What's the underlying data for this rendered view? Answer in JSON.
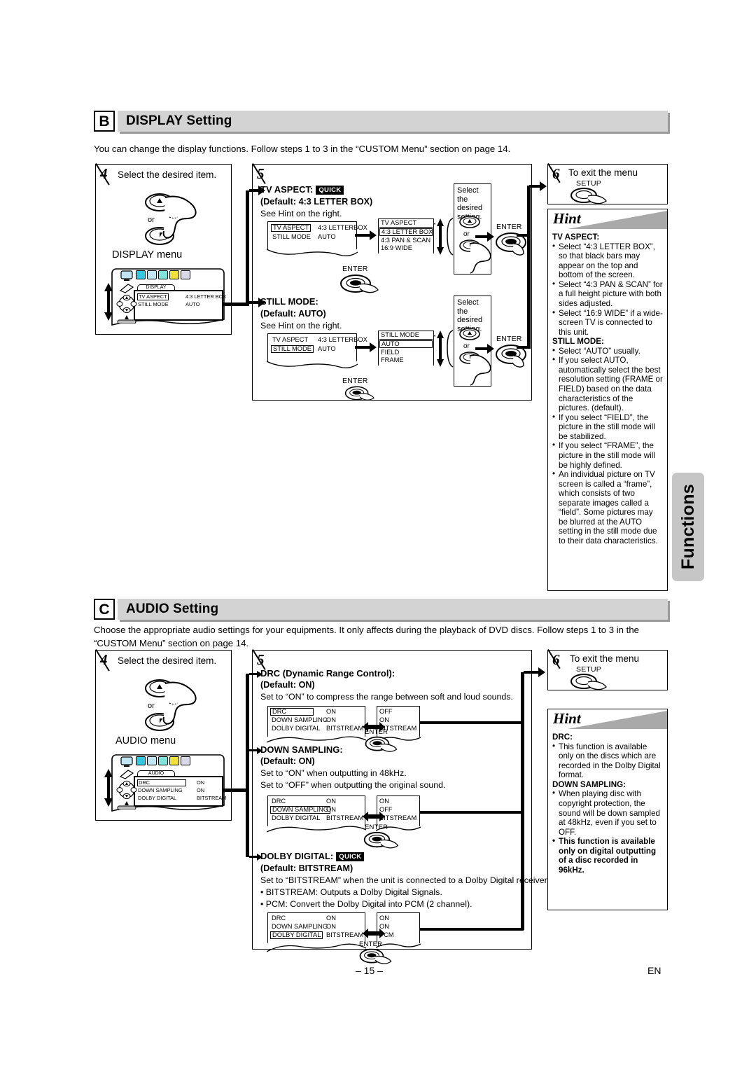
{
  "page": {
    "number": "– 15 –",
    "lang": "EN",
    "side_tab": "Functions"
  },
  "section_b": {
    "letter": "B",
    "title": "DISPLAY Setting",
    "intro": "You can change the display functions. Follow steps 1 to 3 in the “CUSTOM Menu” section on page 14.",
    "step4": {
      "number": "4",
      "label": "Select the desired item.",
      "or": "or",
      "menu_caption": "DISPLAY menu",
      "menu_tab": "DISPLAY",
      "menu_rows": [
        {
          "name": "TV ASPECT",
          "value": "4:3 LETTER BOX",
          "selected": true
        },
        {
          "name": "STILL MODE",
          "value": "AUTO",
          "selected": false
        }
      ],
      "enter_label": "ENTER"
    },
    "step5": {
      "number": "5",
      "items": [
        {
          "title": "TV ASPECT:",
          "quick": "QUICK",
          "default": "(Default: 4:3 LETTER BOX)",
          "note": "See Hint on the right.",
          "osd_rows": [
            {
              "name": "TV ASPECT",
              "value": "4:3 LETTERBOX",
              "selected": true
            },
            {
              "name": "STILL MODE",
              "value": "AUTO",
              "selected": false
            }
          ],
          "list_header": "TV ASPECT",
          "list_options": [
            "4:3 LETTER BOX",
            "4:3 PAN & SCAN",
            "16:9 WIDE"
          ],
          "list_selected": 0,
          "enter_label": "ENTER"
        },
        {
          "title": "STILL MODE:",
          "quick": "",
          "default": "(Default: AUTO)",
          "note": "See Hint on the right.",
          "osd_rows": [
            {
              "name": "TV ASPECT",
              "value": "4:3 LETTERBOX",
              "selected": false
            },
            {
              "name": "STILL MODE",
              "value": "AUTO",
              "selected": true
            }
          ],
          "list_header": "STILL MODE",
          "list_options": [
            "AUTO",
            "FIELD",
            "FRAME"
          ],
          "list_selected": 0,
          "enter_label": "ENTER"
        }
      ],
      "select_setting": {
        "l1": "Select the",
        "l2": "desired",
        "l3": "setting.",
        "or": "or"
      },
      "enter_label": "ENTER"
    },
    "step6": {
      "number": "6",
      "label": "To exit the menu",
      "setup_label": "SETUP"
    },
    "hint": {
      "title": "Hint",
      "groups": [
        {
          "heading": "TV ASPECT:",
          "bullets": [
            "Select “4:3 LETTER BOX”, so that black bars may appear on the top and bottom of the screen.",
            "Select “4:3 PAN & SCAN” for a full height picture with both sides adjusted.",
            "Select “16:9 WIDE” if a wide-screen TV is connected to this unit."
          ]
        },
        {
          "heading": "STILL MODE:",
          "bullets": [
            "Select “AUTO” usually.",
            "If you select AUTO, automatically select the best resolution setting (FRAME or FIELD) based on the data characteristics of the pictures. (default).",
            "If you select “FIELD”, the picture in the still mode will be stabilized.",
            "If you select “FRAME”, the picture in the still mode will be highly defined.",
            "An individual picture on TV screen is called a “frame”, which consists of two separate images called a “field”. Some pictures may be blurred at the AUTO setting in the still mode due to their data characteristics."
          ]
        }
      ]
    }
  },
  "section_c": {
    "letter": "C",
    "title": "AUDIO Setting",
    "intro": "Choose the appropriate audio settings for your equipments. It only affects during the playback of DVD discs. Follow steps 1 to 3 in the “CUSTOM Menu” section on page 14.",
    "step4": {
      "number": "4",
      "label": "Select the desired item.",
      "or": "or",
      "menu_caption": "AUDIO menu",
      "menu_tab": "AUDIO",
      "menu_rows": [
        {
          "name": "DRC",
          "value": "ON",
          "selected": true
        },
        {
          "name": "DOWN SAMPLING",
          "value": "ON",
          "selected": false
        },
        {
          "name": "DOLBY DIGITAL",
          "value": "BITSTREAM",
          "selected": false
        }
      ]
    },
    "step5": {
      "number": "5",
      "items": [
        {
          "title": "DRC (Dynamic Range Control):",
          "quick": "",
          "default": "(Default: ON)",
          "lines": [
            "Set to “ON” to compress the range between soft and loud sounds."
          ],
          "osd_rows": [
            {
              "name": "DRC",
              "value": "ON",
              "selected": true
            },
            {
              "name": "DOWN SAMPLING",
              "value": "ON",
              "selected": false
            },
            {
              "name": "DOLBY DIGITAL",
              "value": "BITSTREAM",
              "selected": false
            }
          ],
          "alt_values": [
            "OFF",
            "ON",
            "BITSTREAM"
          ],
          "enter_label": "ENTER"
        },
        {
          "title": "DOWN SAMPLING:",
          "quick": "",
          "default": "(Default: ON)",
          "lines": [
            "Set to “ON” when outputting in 48kHz.",
            "Set to “OFF” when outputting the original sound."
          ],
          "osd_rows": [
            {
              "name": "DRC",
              "value": "ON",
              "selected": false
            },
            {
              "name": "DOWN SAMPLING",
              "value": "ON",
              "selected": true
            },
            {
              "name": "DOLBY DIGITAL",
              "value": "BITSTREAM",
              "selected": false
            }
          ],
          "alt_values": [
            "ON",
            "OFF",
            "BITSTREAM"
          ],
          "enter_label": "ENTER"
        },
        {
          "title": "DOLBY DIGITAL:",
          "quick": "QUICK",
          "default": "(Default: BITSTREAM)",
          "lines": [
            "Set to “BITSTREAM” when the unit is connected to a Dolby Digital receiver.",
            "• BITSTREAM: Outputs a Dolby Digital Signals.",
            "• PCM: Convert the Dolby Digital into PCM (2 channel)."
          ],
          "osd_rows": [
            {
              "name": "DRC",
              "value": "ON",
              "selected": false
            },
            {
              "name": "DOWN SAMPLING",
              "value": "ON",
              "selected": false
            },
            {
              "name": "DOLBY DIGITAL",
              "value": "BITSTREAM",
              "selected": true
            }
          ],
          "alt_values": [
            "ON",
            "ON",
            "PCM"
          ],
          "enter_label": "ENTER"
        }
      ]
    },
    "step6": {
      "number": "6",
      "label": "To exit the menu",
      "setup_label": "SETUP"
    },
    "hint": {
      "title": "Hint",
      "groups": [
        {
          "heading": "DRC:",
          "bullets": [
            "This function is available only on the discs which are recorded in the Dolby Digital format."
          ]
        },
        {
          "heading": "DOWN SAMPLING:",
          "bullets": [
            "When playing disc with copyright protection, the sound will be down sampled at 48kHz, even if you set to OFF.",
            "This function is available only on digital outputting of a disc recorded in 96kHz."
          ]
        }
      ]
    }
  }
}
